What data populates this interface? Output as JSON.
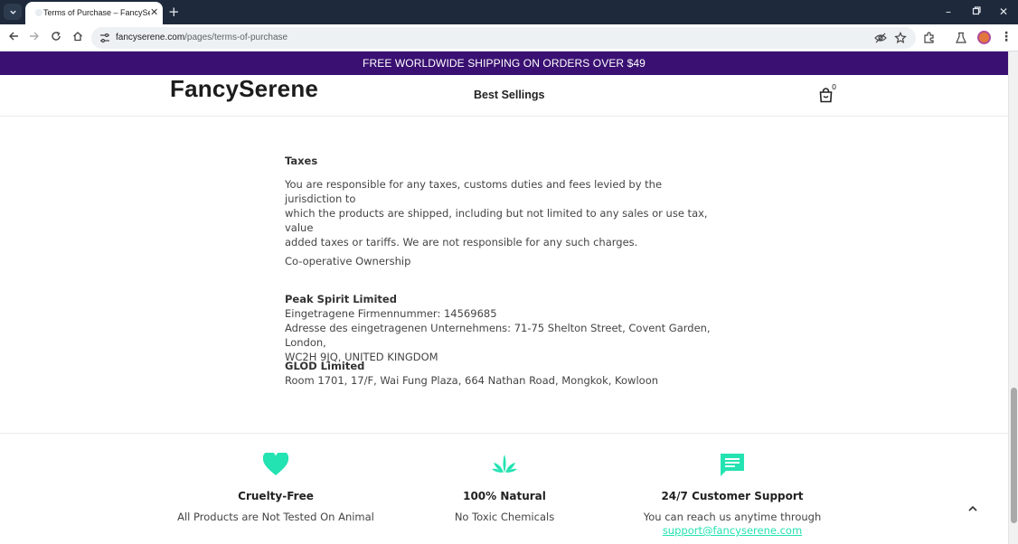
{
  "browser": {
    "tab_title": "Terms of Purchase – FancySerene",
    "url_domain": "fancyserene.com",
    "url_path": "/pages/terms-of-purchase"
  },
  "promo": {
    "text": "FREE WORLDWIDE SHIPPING ON ORDERS OVER $49"
  },
  "header": {
    "logo": "FancySerene",
    "nav_link": "Best Sellings",
    "cart_count": "0"
  },
  "content": {
    "cut_text": "",
    "taxes_heading": "Taxes",
    "taxes_line1": "You are responsible for any taxes, customs duties and fees levied by the jurisdiction to",
    "taxes_line2": "which the products are shipped, including but not limited to any sales or use tax, value",
    "taxes_line3": "added taxes or tariffs. We are not responsible for any such charges.",
    "coop_heading": "Co-operative Ownership",
    "company1_name": "Peak Spirit Limited",
    "company1_reg": "Eingetragene Firmennummer: 14569685",
    "company1_addr1": "Adresse des eingetragenen Unternehmens: 71-75 Shelton Street, Covent Garden, London,",
    "company1_addr2": "WC2H 9JQ, UNITED KINGDOM",
    "company2_name": "GLOD Limited",
    "company2_addr": "Room 1701, 17/F, Wai Fung Plaza, 664 Nathan Road, Mongkok, Kowloon"
  },
  "footer": {
    "features": [
      {
        "title": "Cruelty-Free",
        "desc": "All Products are Not Tested On Animal",
        "icon": "heart-icon"
      },
      {
        "title": "100% Natural",
        "desc": "No Toxic Chemicals",
        "icon": "leaf-icon"
      },
      {
        "title": "24/7 Customer Support",
        "desc": "You can reach us anytime through",
        "link": "support@fancyserene.com",
        "icon": "chat-icon"
      }
    ]
  },
  "colors": {
    "promo_bg": "#3a1072",
    "accent": "#24e3b2",
    "tabbar_bg": "#1e2a3b"
  }
}
